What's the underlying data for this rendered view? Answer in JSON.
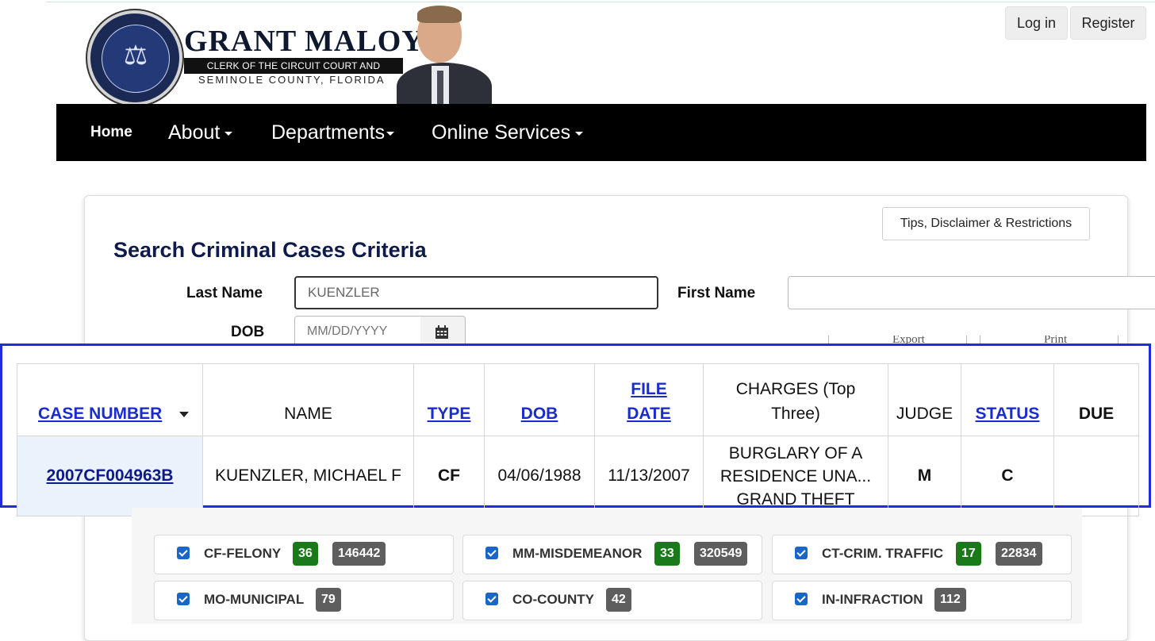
{
  "header": {
    "brand_name": "GRANT MALOY",
    "brand_subtitle": "CLERK OF THE CIRCUIT COURT AND COMPTROLLER",
    "brand_county": "SEMINOLE COUNTY,  FLORIDA",
    "login_label": "Log in",
    "register_label": "Register"
  },
  "nav": {
    "home": "Home",
    "about": "About",
    "departments": "Departments",
    "online_services": "Online Services"
  },
  "search": {
    "tips_label": "Tips, Disclaimer & Restrictions",
    "title": "Search Criminal Cases Criteria",
    "last_name_label": "Last Name",
    "last_name_value": "KUENZLER",
    "first_name_label": "First Name",
    "first_name_value": "",
    "dob_label": "DOB",
    "dob_placeholder": "MM/DD/YYYY",
    "export_label": "Export",
    "print_label": "Print"
  },
  "results": {
    "headers": {
      "case_number": "CASE NUMBER",
      "name": "NAME",
      "type": "TYPE",
      "dob": "DOB",
      "file_date": "FILE DATE",
      "charges": "CHARGES (Top Three)",
      "judge": "JUDGE",
      "status": "STATUS",
      "due": "DUE"
    },
    "rows": [
      {
        "case_number": "2007CF004963B",
        "name": "KUENZLER, MICHAEL F",
        "type": "CF",
        "dob": "04/06/1988",
        "file_date": "11/13/2007",
        "charge_1": "BURGLARY OF A RESIDENCE UNA...",
        "charge_2": "GRAND THEFT",
        "judge": "M",
        "status": "C",
        "due": ""
      }
    ]
  },
  "filters": [
    {
      "label": "CF-FELONY",
      "count": "36",
      "total": "146442"
    },
    {
      "label": "MM-MISDEMEANOR",
      "count": "33",
      "total": "320549"
    },
    {
      "label": "CT-CRIM. TRAFFIC",
      "count": "17",
      "total": "22834"
    },
    {
      "label": "MO-MUNICIPAL",
      "total": "79"
    },
    {
      "label": "CO-COUNTY",
      "total": "42"
    },
    {
      "label": "IN-INFRACTION",
      "total": "112"
    }
  ],
  "colors": {
    "accent_blue": "#1a2bd0",
    "highlight_border": "#1f2bdc",
    "badge_green": "#1a7a1a",
    "badge_gray": "#5e5e5e",
    "nav_bg": "#000000"
  }
}
